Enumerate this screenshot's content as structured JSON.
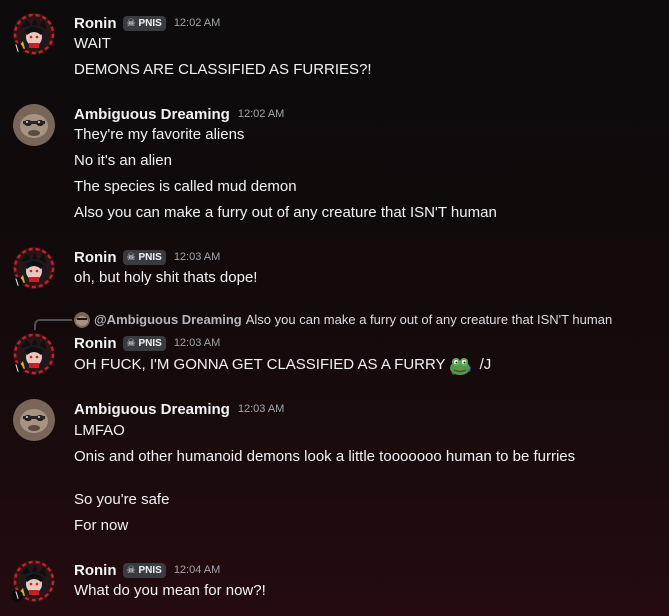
{
  "messages": [
    {
      "author": "Ronin",
      "tag": "PNIS",
      "time": "12:02 AM",
      "lines": [
        "WAIT",
        "DEMONS ARE CLASSIFIED AS FURRIES?!"
      ]
    },
    {
      "author": "Ambiguous Dreaming",
      "time": "12:02 AM",
      "lines": [
        "They're my favorite aliens",
        "No it's an alien",
        "The species is called mud demon",
        "Also you can make a furry out of any creature that ISN'T human"
      ]
    },
    {
      "author": "Ronin",
      "tag": "PNIS",
      "time": "12:03 AM",
      "lines": [
        "oh, but holy shit thats dope!"
      ]
    },
    {
      "reply": {
        "author": "@Ambiguous Dreaming",
        "content": "Also you can make a furry out of any creature that ISN'T human"
      },
      "author": "Ronin",
      "tag": "PNIS",
      "time": "12:03 AM",
      "line_before_emoji": "OH FUCK, I'M GONNA GET CLASSIFIED AS A FURRY",
      "emoji": "frog-emoji",
      "line_after_emoji": "/J"
    },
    {
      "author": "Ambiguous Dreaming",
      "time": "12:03 AM",
      "lines": [
        "LMFAO",
        "Onis and other humanoid demons look a little tooooooo human to be furries",
        "So you're safe",
        "For now"
      ]
    },
    {
      "author": "Ronin",
      "tag": "PNIS",
      "time": "12:04 AM",
      "lines": [
        "What do you mean for now?!"
      ]
    }
  ],
  "status_badge": "\\",
  "tag_icon": "skull-icon",
  "colors": {
    "text": "#f2f3f5",
    "muted": "#a3a6aa",
    "tag_bg": "#3a3b40"
  }
}
